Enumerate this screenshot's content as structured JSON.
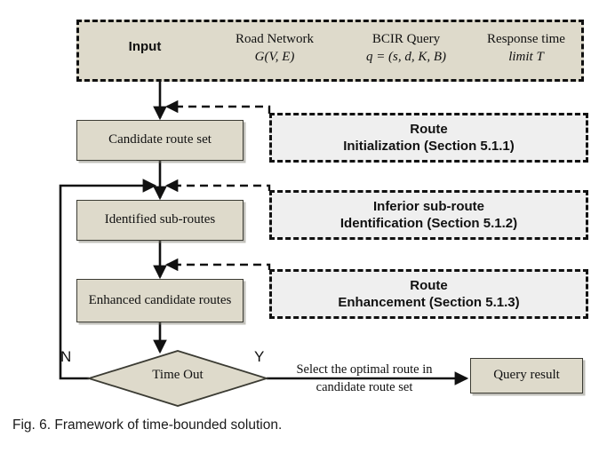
{
  "figure": {
    "caption": "Fig. 6. Framework of time-bounded solution.",
    "colors": {
      "node_fill": "#dedacb",
      "section_fill": "#efefef",
      "stroke": "#111111"
    }
  },
  "input": {
    "label": "Input",
    "fields": [
      {
        "title": "Road Network",
        "formula": "G(V, E)"
      },
      {
        "title": "BCIR Query",
        "formula": "q = (s, d, K, B)"
      },
      {
        "title": "Response time",
        "formula": "limit T"
      }
    ]
  },
  "process_nodes": [
    {
      "id": "candidate-route-set",
      "label": "Candidate route set"
    },
    {
      "id": "identified-sub-routes",
      "label": "Identified sub-routes"
    },
    {
      "id": "enhanced-candidate-routes",
      "label": "Enhanced candidate routes"
    },
    {
      "id": "query-result",
      "label": "Query result"
    }
  ],
  "sections": [
    {
      "id": "route-initialization",
      "line1": "Route",
      "line2": "Initialization (Section 5.1.1)"
    },
    {
      "id": "inferior-sub-route-identification",
      "line1": "Inferior sub-route",
      "line2": "Identification (Section 5.1.2)"
    },
    {
      "id": "route-enhancement",
      "line1": "Route",
      "line2": "Enhancement (Section 5.1.3)"
    }
  ],
  "decision": {
    "label": "Time Out",
    "branch_no": "N",
    "branch_yes": "Y",
    "yes_edge_line1": "Select the optimal route in",
    "yes_edge_line2": "candidate route set"
  }
}
